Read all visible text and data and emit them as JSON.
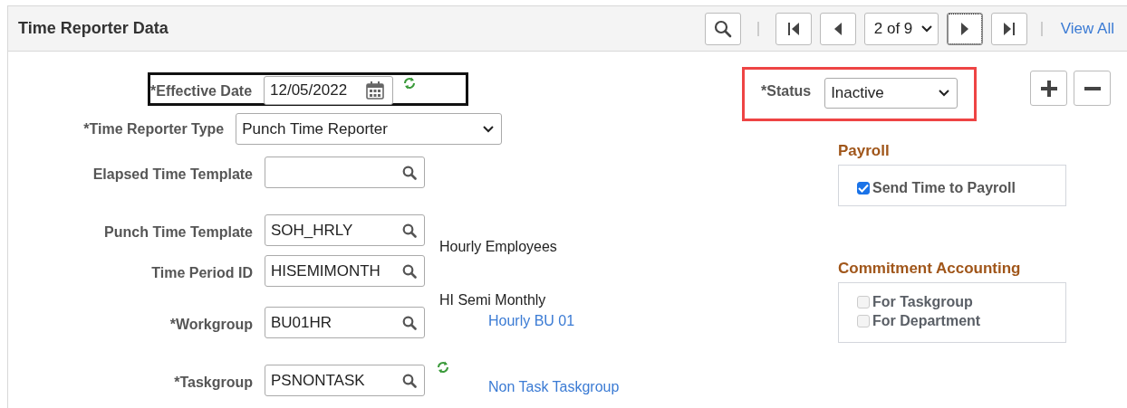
{
  "header": {
    "title": "Time Reporter Data",
    "page_select": "2 of 9",
    "view_all": "View All",
    "nav_buttons": [
      {
        "kind": "first",
        "focused": false
      },
      {
        "kind": "prev",
        "focused": false
      },
      {
        "kind": "next",
        "focused": true
      },
      {
        "kind": "last",
        "focused": false
      }
    ]
  },
  "effective_date": {
    "label": "*Effective Date",
    "value": "12/05/2022",
    "highlighted": true
  },
  "fields": [
    {
      "kind": "select",
      "label": "*Time Reporter Type",
      "value": "Punch Time Reporter",
      "refresh": false
    },
    {
      "kind": "prompt",
      "label": "Elapsed Time Template",
      "refresh": false
    },
    {
      "kind": "prompt",
      "label": "Punch Time Template",
      "value": "SOH_HRLY",
      "refresh": false,
      "description": "Hourly Employees"
    },
    {
      "kind": "prompt",
      "label": "Time Period ID",
      "value": "HISEMIMONTH",
      "refresh": false,
      "description": "HI Semi Monthly"
    },
    {
      "kind": "prompt",
      "label": "*Workgroup",
      "value": "BU01HR",
      "refresh": false,
      "description_link": "Hourly BU 01"
    },
    {
      "kind": "prompt",
      "label": "*Taskgroup",
      "value": "PSNONTASK",
      "refresh": true,
      "description_link": "Non Task Taskgroup"
    }
  ],
  "status": {
    "label": "*Status",
    "value": "Inactive",
    "highlighted": true
  },
  "payroll": {
    "heading": "Payroll",
    "checkboxes": [
      {
        "label": "Send Time to Payroll",
        "checked": true,
        "disabled": false
      }
    ]
  },
  "commitment_accounting": {
    "heading": "Commitment Accounting",
    "checkboxes": [
      {
        "label": "For Taskgroup",
        "checked": false,
        "disabled": true
      },
      {
        "label": "For Department",
        "checked": false,
        "disabled": true
      }
    ]
  }
}
